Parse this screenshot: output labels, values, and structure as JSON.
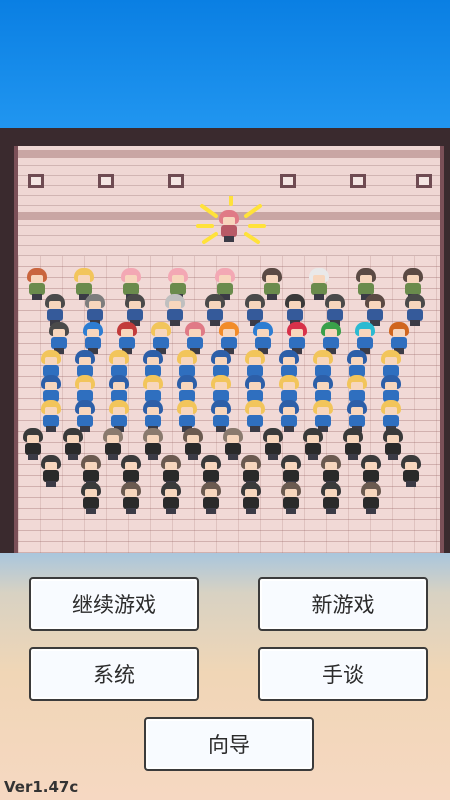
{
  "menu": {
    "continue_label": "继续游戏",
    "new_game_label": "新游戏",
    "system_label": "系统",
    "manual_label": "手谈",
    "guide_label": "向导"
  },
  "version": "Ver1.47c",
  "colors": {
    "sky": "#1e8fe8",
    "wall": "#efd7d4",
    "floor": "#f1d9d6",
    "button_bg": "#f8fbff",
    "button_border": "#3b3b3b"
  },
  "icons": [
    "sparkle-burst-icon"
  ]
}
